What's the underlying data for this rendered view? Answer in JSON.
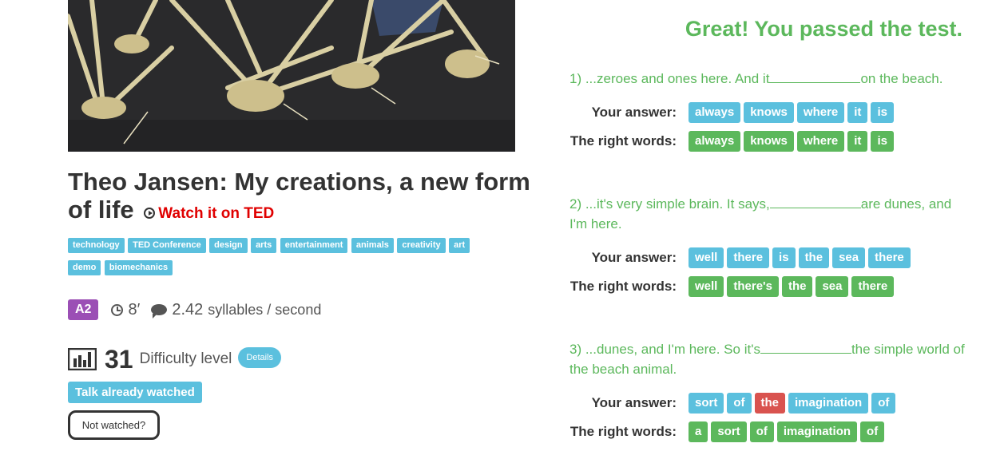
{
  "talk": {
    "title": "Theo Jansen: My creations, a new form of life",
    "watch_label": "Watch it on TED",
    "tags": [
      "technology",
      "TED Conference",
      "design",
      "arts",
      "entertainment",
      "animals",
      "creativity",
      "art",
      "demo",
      "biomechanics"
    ],
    "level": "A2",
    "duration": "8′",
    "syllables_value": "2.42",
    "syllables_unit": "syllables / second",
    "difficulty_value": "31",
    "difficulty_label": "Difficulty level",
    "details_label": "Details",
    "watched_label": "Talk already watched",
    "not_watched_label": "Not watched?"
  },
  "result": {
    "title": "Great! You passed the test.",
    "your_answer_label": "Your answer:",
    "right_words_label": "The right words:",
    "questions": [
      {
        "before": "1) ...zeroes and ones here. And it",
        "after": "on the beach.",
        "answer": [
          {
            "w": "always",
            "s": "blue"
          },
          {
            "w": "knows",
            "s": "blue"
          },
          {
            "w": "where",
            "s": "blue"
          },
          {
            "w": "it",
            "s": "blue"
          },
          {
            "w": "is",
            "s": "blue"
          }
        ],
        "right": [
          "always",
          "knows",
          "where",
          "it",
          "is"
        ]
      },
      {
        "before": "2) ...it's very simple brain. It says,",
        "after": "are dunes, and I'm here.",
        "answer": [
          {
            "w": "well",
            "s": "blue"
          },
          {
            "w": "there",
            "s": "blue"
          },
          {
            "w": "is",
            "s": "blue"
          },
          {
            "w": "the",
            "s": "blue"
          },
          {
            "w": "sea",
            "s": "blue"
          },
          {
            "w": "there",
            "s": "blue"
          }
        ],
        "right": [
          "well",
          "there's",
          "the",
          "sea",
          "there"
        ]
      },
      {
        "before": "3) ...dunes, and I'm here. So it's",
        "after": "the simple world of the beach animal.",
        "answer": [
          {
            "w": "sort",
            "s": "blue"
          },
          {
            "w": "of",
            "s": "blue"
          },
          {
            "w": "the",
            "s": "red"
          },
          {
            "w": "imagination",
            "s": "blue"
          },
          {
            "w": "of",
            "s": "blue"
          }
        ],
        "right": [
          "a",
          "sort",
          "of",
          "imagination",
          "of"
        ]
      }
    ]
  },
  "colors": {
    "info": "#5bc0de",
    "success": "#5cb85c",
    "danger": "#d9534f",
    "level": "#9b4fb5",
    "link": "#e00000"
  }
}
